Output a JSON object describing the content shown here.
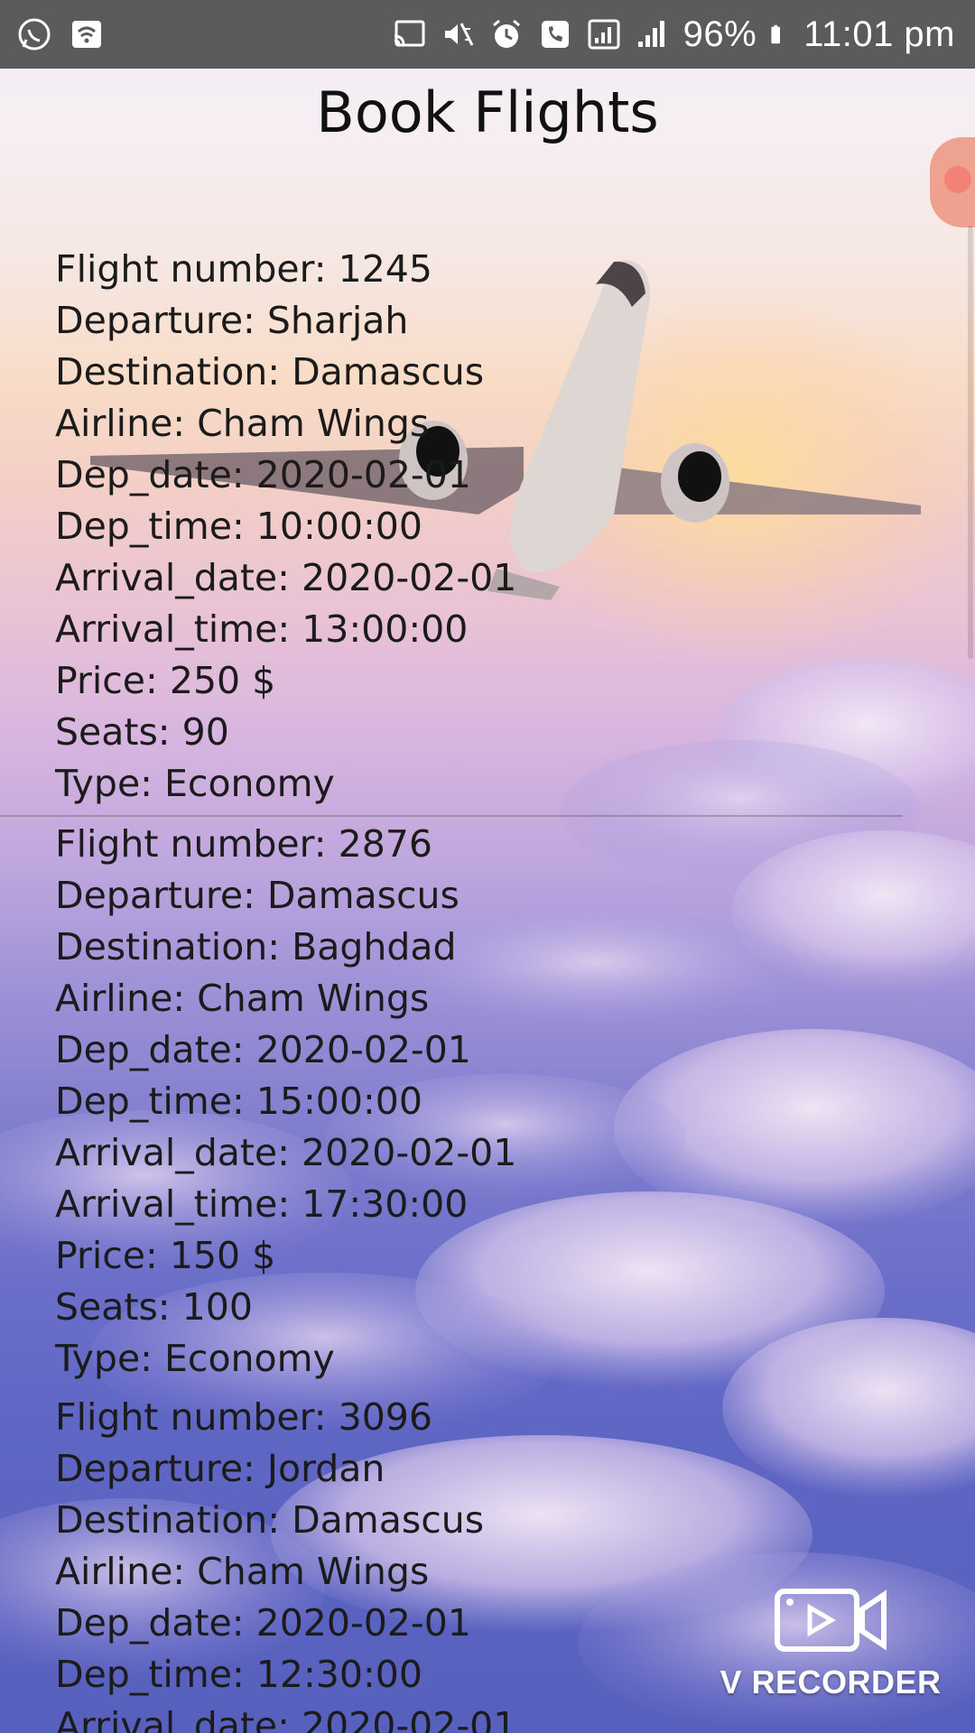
{
  "status_bar": {
    "left_icons": [
      "whatsapp-icon",
      "wifi-hotspot-icon"
    ],
    "right_icons": [
      "cast-icon",
      "mute-vibrate-icon",
      "alarm-icon",
      "call-icon",
      "signal-box-icon",
      "signal-bars-icon",
      "battery-icon"
    ],
    "battery": "96%",
    "time": "11:01 pm"
  },
  "page": {
    "title": "Book Flights"
  },
  "flights": [
    {
      "flight_number": "Flight number: 1245",
      "departure": "Departure: Sharjah",
      "destination": "Destination: Damascus",
      "airline": "Airline: Cham Wings",
      "dep_date": "Dep_date: 2020-02-01",
      "dep_time": "Dep_time: 10:00:00",
      "arrival_date": "Arrival_date: 2020-02-01",
      "arrival_time": "Arrival_time: 13:00:00",
      "price": "Price: 250 $",
      "seats": "Seats: 90",
      "type": "Type: Economy"
    },
    {
      "flight_number": "Flight number: 2876",
      "departure": "Departure: Damascus",
      "destination": "Destination: Baghdad",
      "airline": "Airline: Cham Wings",
      "dep_date": "Dep_date: 2020-02-01",
      "dep_time": "Dep_time: 15:00:00",
      "arrival_date": "Arrival_date: 2020-02-01",
      "arrival_time": "Arrival_time: 17:30:00",
      "price": "Price: 150 $",
      "seats": "Seats: 100",
      "type": "Type: Economy"
    },
    {
      "flight_number": "Flight number: 3096",
      "departure": "Departure: Jordan",
      "destination": "Destination: Damascus",
      "airline": "Airline: Cham Wings",
      "dep_date": "Dep_date: 2020-02-01",
      "dep_time": "Dep_time: 12:30:00",
      "arrival_date": "Arrival_date: 2020-02-01"
    }
  ],
  "watermark": {
    "icon": "video-recorder-icon",
    "label": "V RECORDER"
  },
  "colors": {
    "status_bar": "#5b5b5b",
    "text": "#1b1b1b",
    "sky_top": "#f1eef6",
    "sky_bottom": "#5760bd"
  }
}
